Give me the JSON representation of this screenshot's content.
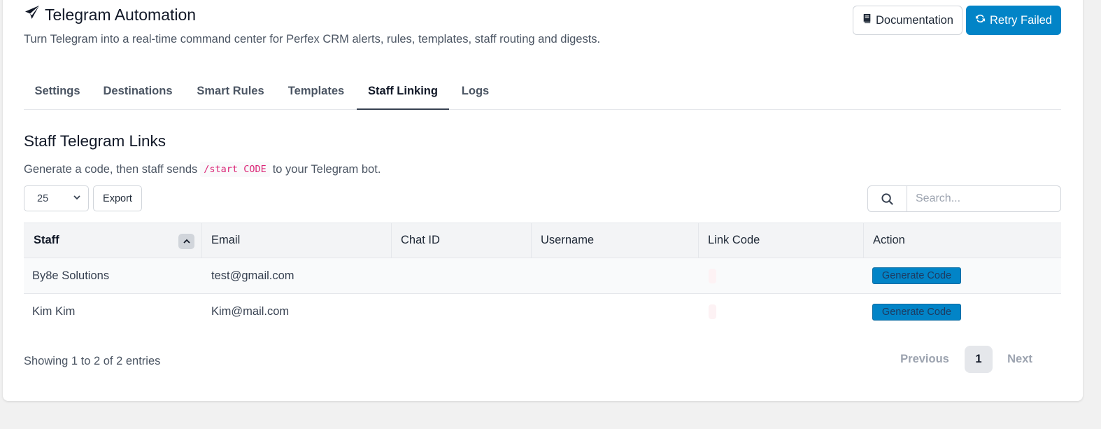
{
  "header": {
    "title": "Telegram Automation",
    "subtitle": "Turn Telegram into a real-time command center for Perfex CRM alerts, rules, templates, staff routing and digests.",
    "documentation_label": "Documentation",
    "retry_label": "Retry Failed"
  },
  "tabs": [
    {
      "label": "Settings",
      "active": false
    },
    {
      "label": "Destinations",
      "active": false
    },
    {
      "label": "Smart Rules",
      "active": false
    },
    {
      "label": "Templates",
      "active": false
    },
    {
      "label": "Staff Linking",
      "active": true
    },
    {
      "label": "Logs",
      "active": false
    }
  ],
  "section": {
    "title": "Staff Telegram Links",
    "help_before": "Generate a code, then staff sends",
    "help_code": "/start CODE",
    "help_after": "to your Telegram bot."
  },
  "controls": {
    "page_length": "25",
    "export_label": "Export",
    "search_placeholder": "Search..."
  },
  "table": {
    "columns": [
      "Staff",
      "Email",
      "Chat ID",
      "Username",
      "Link Code",
      "Action"
    ],
    "sorted_column": "Staff",
    "rows": [
      {
        "staff": "By8e Solutions",
        "email": "test@gmail.com",
        "chat_id": "",
        "username": "",
        "link_code": "",
        "action": "Generate Code"
      },
      {
        "staff": "Kim Kim",
        "email": "Kim@mail.com",
        "chat_id": "",
        "username": "",
        "link_code": "",
        "action": "Generate Code"
      }
    ]
  },
  "footer": {
    "info": "Showing 1 to 2 of 2 entries",
    "previous_label": "Previous",
    "current_page": "1",
    "next_label": "Next"
  },
  "colors": {
    "primary": "#0284c7",
    "code_text": "#db2777"
  },
  "icons": {
    "title": "paper-plane-icon",
    "documentation": "book-icon",
    "retry": "refresh-icon",
    "search": "search-icon",
    "sort": "chevron-up-icon",
    "select": "chevron-down-icon"
  }
}
